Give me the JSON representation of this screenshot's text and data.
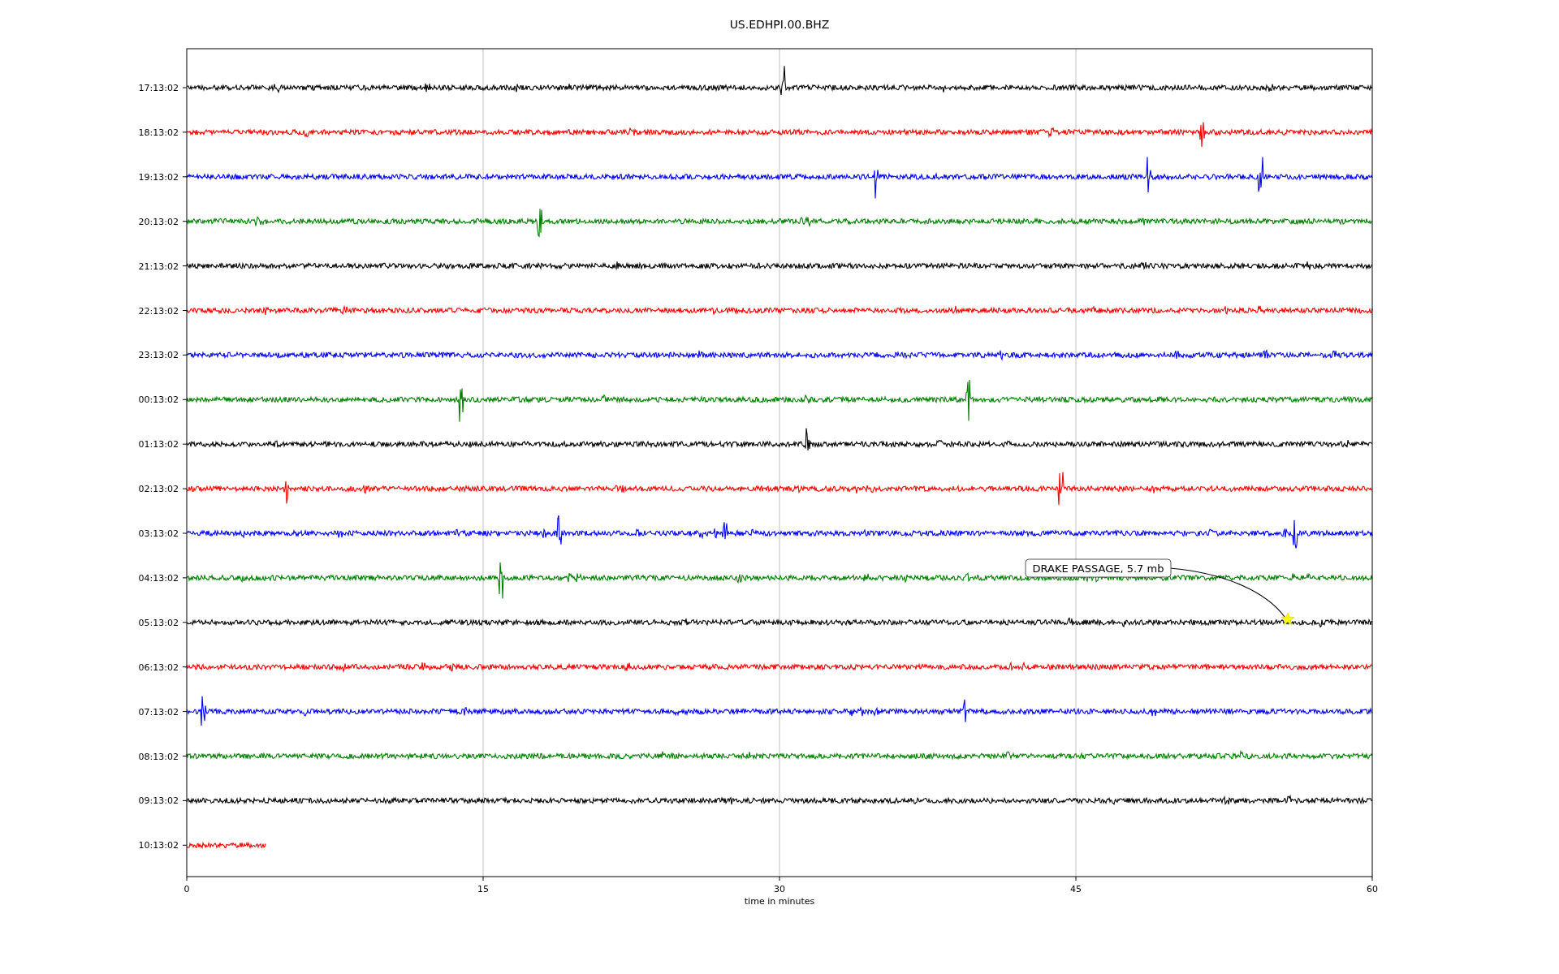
{
  "title": "US.EDHPI.00.BHZ",
  "xlabel": "time in minutes",
  "xticks": [
    "0",
    "15",
    "30",
    "45",
    "60"
  ],
  "traces": [
    {
      "label": "17:13:02",
      "color": "#000000",
      "kind": "full"
    },
    {
      "label": "18:13:02",
      "color": "#ff0000",
      "kind": "full"
    },
    {
      "label": "19:13:02",
      "color": "#0000ff",
      "kind": "full"
    },
    {
      "label": "20:13:02",
      "color": "#008000",
      "kind": "full"
    },
    {
      "label": "21:13:02",
      "color": "#000000",
      "kind": "full"
    },
    {
      "label": "22:13:02",
      "color": "#ff0000",
      "kind": "full"
    },
    {
      "label": "23:13:02",
      "color": "#0000ff",
      "kind": "full"
    },
    {
      "label": "00:13:02",
      "color": "#008000",
      "kind": "full"
    },
    {
      "label": "01:13:02",
      "color": "#000000",
      "kind": "full"
    },
    {
      "label": "02:13:02",
      "color": "#ff0000",
      "kind": "full"
    },
    {
      "label": "03:13:02",
      "color": "#0000ff",
      "kind": "full"
    },
    {
      "label": "04:13:02",
      "color": "#008000",
      "kind": "full"
    },
    {
      "label": "05:13:02",
      "color": "#000000",
      "kind": "full"
    },
    {
      "label": "06:13:02",
      "color": "#ff0000",
      "kind": "full"
    },
    {
      "label": "07:13:02",
      "color": "#0000ff",
      "kind": "full"
    },
    {
      "label": "08:13:02",
      "color": "#008000",
      "kind": "full"
    },
    {
      "label": "09:13:02",
      "color": "#000000",
      "kind": "full"
    },
    {
      "label": "10:13:02",
      "color": "#ff0000",
      "kind": "partial"
    }
  ],
  "annotation": {
    "text": "DRAKE PASSAGE, 5.7 mb"
  }
}
